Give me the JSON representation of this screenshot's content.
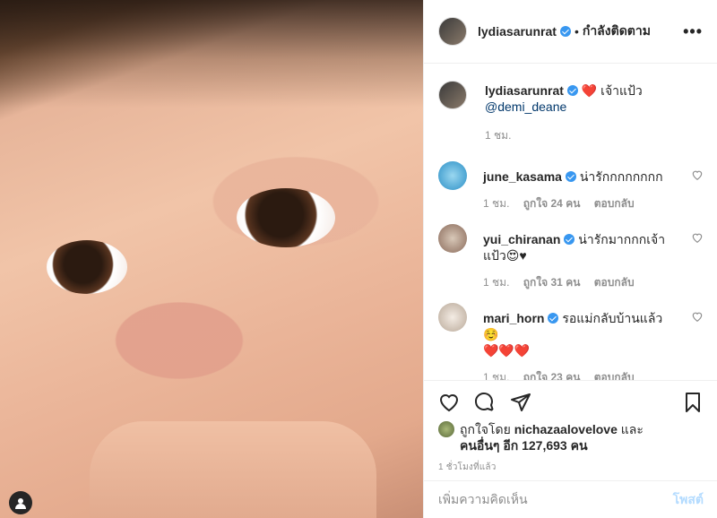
{
  "post_header": {
    "username": "lydiasarunrat",
    "separator": "•",
    "follow_status": "กำลังติดตาม",
    "more": "•••"
  },
  "caption": {
    "username": "lydiasarunrat",
    "heart": "❤️",
    "text": " เจ้าแป้ว",
    "mention": "@demi_deane",
    "time": "1 ชม."
  },
  "comments": [
    {
      "username": "june_kasama",
      "text": "น่ารักกกกกกกก",
      "time": "1 ชม.",
      "likes": "ถูกใจ 24 คน",
      "reply": "ตอบกลับ"
    },
    {
      "username": "yui_chiranan",
      "text": "น่ารักมากกกเจ้าแป้ว😍♥",
      "time": "1 ชม.",
      "likes": "ถูกใจ 31 คน",
      "reply": "ตอบกลับ"
    },
    {
      "username": "mari_horn",
      "text": "รอแม่กลับบ้านแล้ว ☺️",
      "text2": "❤️❤️❤️",
      "time": "1 ชม.",
      "likes": "ถูกใจ 23 คน",
      "reply": "ตอบกลับ"
    }
  ],
  "likes": {
    "prefix": "ถูกใจโดย ",
    "first_user": "nichazaalovelove",
    "and": " และ",
    "others": "คนอื่นๆ อีก 127,693 คน"
  },
  "timestamp": "1 ชั่วโมงที่แล้ว",
  "add_comment": {
    "placeholder": "เพิ่มความคิดเห็น",
    "post_label": "โพสต์"
  },
  "colors": {
    "verified": "#3897f0",
    "link": "#00376b",
    "muted": "#8e8e8e",
    "post_disabled": "#b3dbff"
  }
}
